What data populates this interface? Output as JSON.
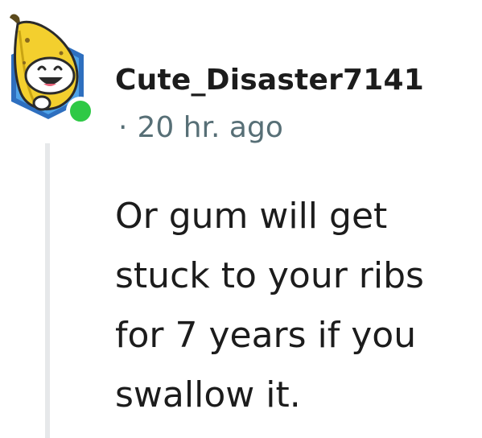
{
  "comment": {
    "author": {
      "username": "Cute_Disaster7141",
      "avatar_icon": "banana-snoo-avatar-icon",
      "online_status_color": "#2ec946"
    },
    "meta": {
      "separator": "·",
      "timestamp": "20 hr. ago"
    },
    "body_lines": [
      "Or gum will get",
      "stuck to your ribs",
      "for 7 years if you",
      "swallow it."
    ]
  }
}
